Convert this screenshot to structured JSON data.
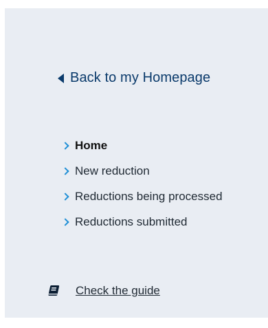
{
  "back": {
    "label": "Back to my Homepage",
    "icon": "caret-left-icon",
    "color": "#0a3a6b"
  },
  "nav": {
    "items": [
      {
        "label": "Home",
        "active": true
      },
      {
        "label": "New reduction",
        "active": false
      },
      {
        "label": "Reductions being processed",
        "active": false
      },
      {
        "label": "Reductions submitted",
        "active": false
      }
    ],
    "chevron_color": "#1f8fd6"
  },
  "guide": {
    "label": "Check the guide",
    "icon": "book-icon"
  },
  "panel_color": "#e9edf3"
}
